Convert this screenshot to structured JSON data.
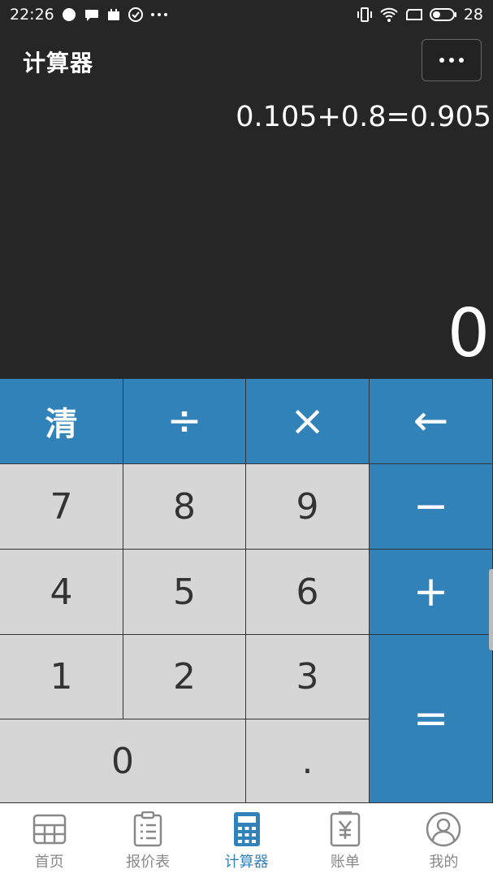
{
  "status_bar": {
    "time": "22:26",
    "battery": "28"
  },
  "header": {
    "title": "计算器"
  },
  "display": {
    "expression": "0.105+0.8=0.905",
    "result": "0"
  },
  "keys": {
    "clear": "清",
    "divide": "÷",
    "multiply": "×",
    "backspace": "←",
    "seven": "7",
    "eight": "8",
    "nine": "9",
    "minus": "−",
    "four": "4",
    "five": "5",
    "six": "6",
    "plus": "+",
    "one": "1",
    "two": "2",
    "three": "3",
    "equals": "=",
    "zero": "0",
    "dot": "."
  },
  "tabs": [
    {
      "label": "首页",
      "icon": "grid-icon",
      "active": false
    },
    {
      "label": "报价表",
      "icon": "clipboard-list-icon",
      "active": false
    },
    {
      "label": "计算器",
      "icon": "calculator-icon",
      "active": true
    },
    {
      "label": "账单",
      "icon": "yuan-receipt-icon",
      "active": false
    },
    {
      "label": "我的",
      "icon": "user-circle-icon",
      "active": false
    }
  ],
  "colors": {
    "accent": "#3282ba",
    "background": "#262626",
    "key_light": "#d6d6d6"
  }
}
